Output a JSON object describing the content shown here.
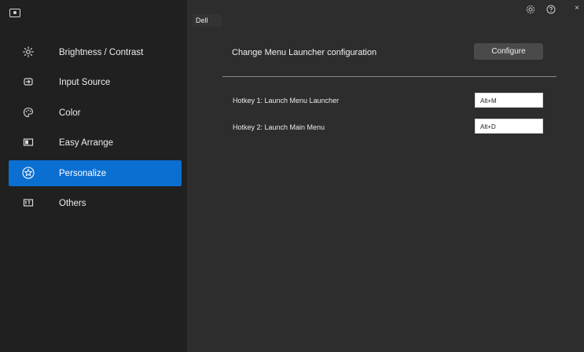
{
  "sidebar": {
    "items": [
      {
        "label": "Brightness / Contrast",
        "icon": "sun-icon"
      },
      {
        "label": "Input Source",
        "icon": "input-source-icon"
      },
      {
        "label": "Color",
        "icon": "palette-icon"
      },
      {
        "label": "Easy Arrange",
        "icon": "easy-arrange-icon"
      },
      {
        "label": "Personalize",
        "icon": "star-icon",
        "active": true
      },
      {
        "label": "Others",
        "icon": "others-icon"
      }
    ]
  },
  "header": {
    "monitor_tab": "Dell",
    "settings_icon": "gear-icon",
    "help_icon": "help-icon",
    "close_label": "×"
  },
  "main": {
    "launcher_label": "Change Menu Launcher configuration",
    "configure_label": "Configure",
    "hotkey1_label": "Hotkey 1: Launch Menu Launcher",
    "hotkey1_value": "Alt+M",
    "hotkey2_label": "Hotkey 2: Launch Main Menu",
    "hotkey2_value": "Alt+D"
  },
  "colors": {
    "sidebar_bg": "#202020",
    "main_bg": "#2d2d2d",
    "accent": "#0b6fd1",
    "button_bg": "#4a4a4a"
  }
}
